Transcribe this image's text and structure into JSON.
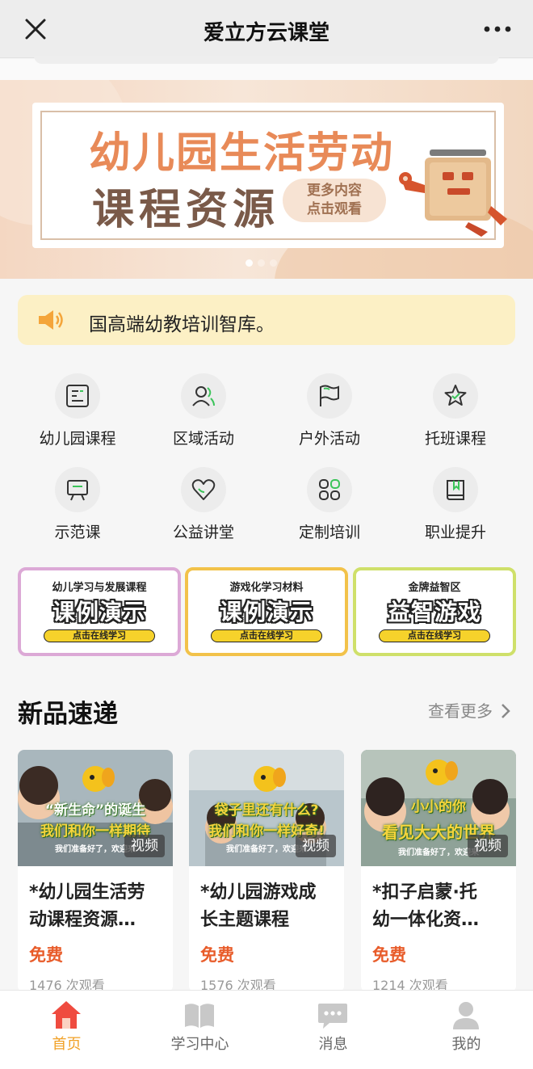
{
  "app": {
    "title": "爱立方云课堂"
  },
  "banner": {
    "line1": "幼儿园生活劳动",
    "line2": "课程资源",
    "cta_line1": "更多内容",
    "cta_line2": "点击观看"
  },
  "notice": {
    "text": "国高端幼教培训智库。"
  },
  "grid": [
    {
      "label": "幼儿园课程",
      "icon": "document-icon"
    },
    {
      "label": "区域活动",
      "icon": "users-icon"
    },
    {
      "label": "户外活动",
      "icon": "flag-icon"
    },
    {
      "label": "托班课程",
      "icon": "star-icon"
    },
    {
      "label": "示范课",
      "icon": "presentation-icon"
    },
    {
      "label": "公益讲堂",
      "icon": "heart-icon"
    },
    {
      "label": "定制培训",
      "icon": "grid-icon"
    },
    {
      "label": "职业提升",
      "icon": "book-icon"
    }
  ],
  "promos": [
    {
      "sub": "幼儿学习与发展课程",
      "big": "课例演示",
      "btn": "点击在线学习",
      "border": "#dca9d6"
    },
    {
      "sub": "游戏化学习材料",
      "big": "课例演示",
      "btn": "点击在线学习",
      "border": "#f2c24a"
    },
    {
      "sub": "金牌益智区",
      "big": "益智游戏",
      "btn": "点击在线学习",
      "border": "#cfe06a"
    }
  ],
  "section": {
    "title": "新品速递",
    "more": "查看更多"
  },
  "products": [
    {
      "name_line1": "*幼儿园生活劳",
      "name_line2": "动课程资源…",
      "price": "免费",
      "views": "1476 次观看",
      "badge": "视频",
      "overlay1": "“新生命”的诞生",
      "overlay2": "我们和你一样期待",
      "overlay3": "我们准备好了，欢迎来"
    },
    {
      "name_line1": "*幼儿园游戏成",
      "name_line2": "长主题课程",
      "price": "免费",
      "views": "1576 次观看",
      "badge": "视频",
      "overlay1": "袋子里还有什么?",
      "overlay2": "我们和你一样好奇!",
      "overlay3": "我们准备好了，欢迎来"
    },
    {
      "name_line1": "*扣子启蒙·托",
      "name_line2": "幼一体化资…",
      "price": "免费",
      "views": "1214 次观看",
      "badge": "视频",
      "overlay1": "小小的你",
      "overlay2": "看见大大的世界",
      "overlay3": "我们准备好了，欢迎来"
    }
  ],
  "tabs": [
    {
      "label": "首页",
      "icon": "home-icon",
      "active": true
    },
    {
      "label": "学习中心",
      "icon": "open-book-icon",
      "active": false
    },
    {
      "label": "消息",
      "icon": "chat-icon",
      "active": false
    },
    {
      "label": "我的",
      "icon": "person-icon",
      "active": false
    }
  ],
  "colors": {
    "accent": "#f1a025",
    "price": "#e85c2a",
    "notice_bg": "#fcf0c5"
  }
}
